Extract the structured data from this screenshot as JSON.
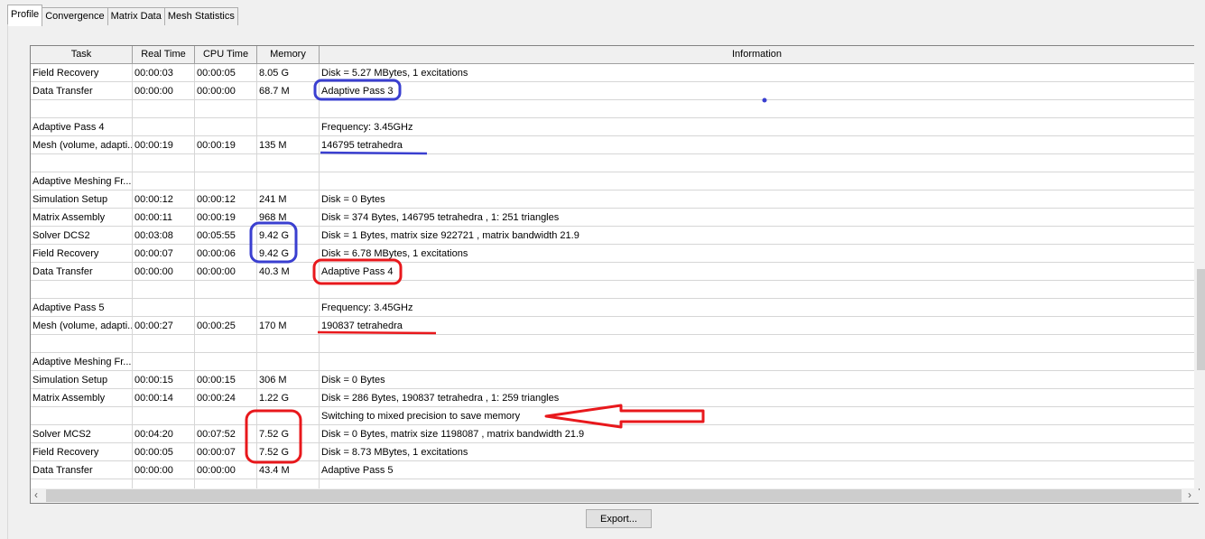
{
  "tabs": [
    "Profile",
    "Convergence",
    "Matrix Data",
    "Mesh Statistics"
  ],
  "columns": [
    "Task",
    "Real Time",
    "CPU Time",
    "Memory",
    "Information"
  ],
  "rows": [
    [
      "Field Recovery",
      "00:00:03",
      "00:00:05",
      "8.05 G",
      "Disk = 5.27 MBytes, 1 excitations"
    ],
    [
      "Data Transfer",
      "00:00:00",
      "00:00:00",
      "68.7 M",
      "Adaptive Pass 3"
    ],
    [
      "",
      "",
      "",
      "",
      ""
    ],
    [
      "Adaptive Pass 4",
      "",
      "",
      "",
      "Frequency:  3.45GHz"
    ],
    [
      "Mesh (volume, adapti...",
      "00:00:19",
      "00:00:19",
      "135 M",
      "146795 tetrahedra"
    ],
    [
      "",
      "",
      "",
      "",
      ""
    ],
    [
      "Adaptive Meshing Fr...",
      "",
      "",
      "",
      ""
    ],
    [
      "Simulation Setup",
      "00:00:12",
      "00:00:12",
      "241 M",
      "Disk = 0 Bytes"
    ],
    [
      "Matrix Assembly",
      "00:00:11",
      "00:00:19",
      "968 M",
      "Disk = 374 Bytes, 146795 tetrahedra , 1: 251 triangles"
    ],
    [
      "Solver DCS2",
      "00:03:08",
      "00:05:55",
      "9.42 G",
      "Disk = 1 Bytes, matrix size 922721 , matrix bandwidth  21.9"
    ],
    [
      "Field Recovery",
      "00:00:07",
      "00:00:06",
      "9.42 G",
      "Disk = 6.78 MBytes, 1 excitations"
    ],
    [
      "Data Transfer",
      "00:00:00",
      "00:00:00",
      "40.3 M",
      "Adaptive Pass 4"
    ],
    [
      "",
      "",
      "",
      "",
      ""
    ],
    [
      "Adaptive Pass 5",
      "",
      "",
      "",
      "Frequency:  3.45GHz"
    ],
    [
      "Mesh (volume, adapti...",
      "00:00:27",
      "00:00:25",
      "170 M",
      "190837 tetrahedra"
    ],
    [
      "",
      "",
      "",
      "",
      ""
    ],
    [
      "Adaptive Meshing Fr...",
      "",
      "",
      "",
      ""
    ],
    [
      "Simulation Setup",
      "00:00:15",
      "00:00:15",
      "306 M",
      "Disk = 0 Bytes"
    ],
    [
      "Matrix Assembly",
      "00:00:14",
      "00:00:24",
      "1.22 G",
      "Disk = 286 Bytes, 190837 tetrahedra , 1: 259 triangles"
    ],
    [
      "",
      "",
      "",
      "",
      "Switching to mixed precision to save memory"
    ],
    [
      "Solver MCS2",
      "00:04:20",
      "00:07:52",
      "7.52 G",
      "Disk = 0 Bytes, matrix size 1198087 , matrix bandwidth  21.9"
    ],
    [
      "Field Recovery",
      "00:00:05",
      "00:00:07",
      "7.52 G",
      "Disk = 8.73 MBytes, 1 excitations"
    ],
    [
      "Data Transfer",
      "00:00:00",
      "00:00:00",
      "43.4 M",
      "Adaptive Pass 5"
    ],
    [
      "",
      "",
      "",
      "",
      ""
    ]
  ],
  "export_label": "Export...",
  "colors": {
    "annotation_blue": "#3a3fd0",
    "annotation_red": "#e8181c"
  }
}
